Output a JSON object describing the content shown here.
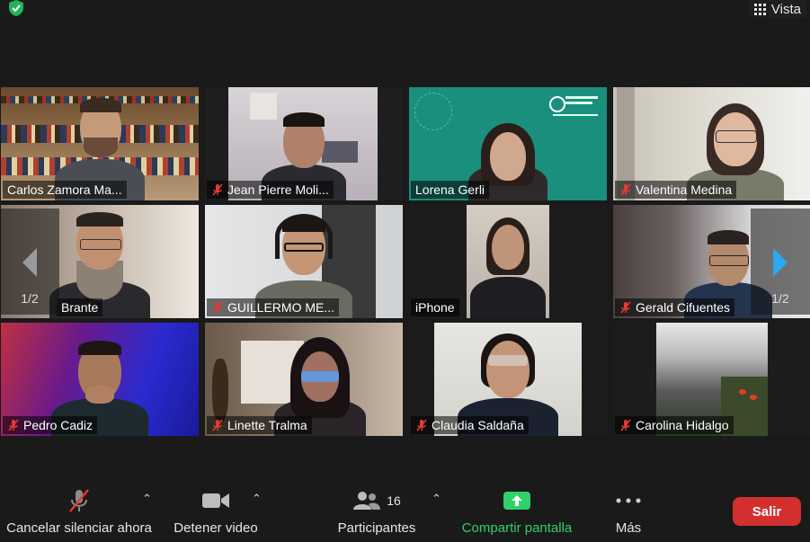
{
  "top": {
    "view_label": "Vista"
  },
  "participants": [
    {
      "name": "Carlos Zamora Ma...",
      "muted": false
    },
    {
      "name": "Jean Pierre Moli...",
      "muted": true
    },
    {
      "name": "Lorena Gerli",
      "muted": false
    },
    {
      "name": "Valentina Medina",
      "muted": true
    },
    {
      "name": "Brante",
      "muted": false
    },
    {
      "name": "GUILLERMO ME...",
      "muted": true
    },
    {
      "name": "iPhone",
      "muted": false
    },
    {
      "name": "Gerald Cifuentes",
      "muted": true
    },
    {
      "name": "Pedro Cadiz",
      "muted": true
    },
    {
      "name": "Linette Tralma",
      "muted": true
    },
    {
      "name": "Claudia Saldaña",
      "muted": true
    },
    {
      "name": "Carolina Hidalgo",
      "muted": true
    }
  ],
  "pager": {
    "left_page": "1/2",
    "right_page": "1/2"
  },
  "toolbar": {
    "unmute_label": "Cancelar silenciar ahora",
    "video_label": "Detener video",
    "participants_label": "Participantes",
    "participants_count": "16",
    "share_label": "Compartir pantalla",
    "more_label": "Más",
    "leave_label": "Salir"
  },
  "colors": {
    "active_speaker": "#e8f25a",
    "share_green": "#2fd16a",
    "leave_red": "#d32f2f",
    "pager_arrow": "#2aa8f0"
  },
  "icons": [
    "shield-check-icon",
    "grid-icon",
    "mic-muted-icon",
    "video-camera-icon",
    "people-icon",
    "share-screen-icon",
    "more-dots-icon",
    "chevron-up-icon",
    "chevron-left-icon",
    "chevron-right-icon"
  ]
}
